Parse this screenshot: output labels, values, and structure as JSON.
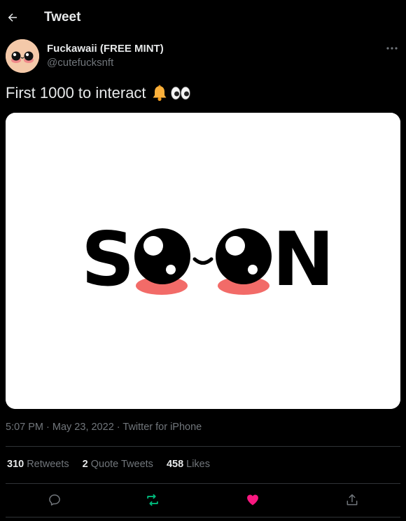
{
  "header": {
    "title": "Tweet",
    "back_icon": "arrow-left-icon"
  },
  "author": {
    "display_name": "Fuckawaii (FREE MINT)",
    "handle": "@cutefucksnft",
    "avatar_icon": "kawaii-face-avatar",
    "more_icon": "more-horizontal-icon"
  },
  "tweet": {
    "text": "First 1000 to interact",
    "emojis": [
      "bell-emoji",
      "eyes-emoji"
    ],
    "media": {
      "wordmark": "SOON",
      "description_icon": "soon-kawaii-eyes-image"
    },
    "time": "5:07 PM",
    "separator": " · ",
    "date": "May 23, 2022",
    "source": "Twitter for iPhone"
  },
  "stats": {
    "retweets": {
      "count": "310",
      "label": "Retweets"
    },
    "quotes": {
      "count": "2",
      "label": "Quote Tweets"
    },
    "likes": {
      "count": "458",
      "label": "Likes"
    }
  },
  "actions": {
    "reply_icon": "reply-icon",
    "retweet_icon": "retweet-icon",
    "like_icon": "heart-icon",
    "share_icon": "share-icon"
  },
  "colors": {
    "background": "#000000",
    "text_primary": "#e7e9ea",
    "text_secondary": "#71767b",
    "divider": "#2f3336",
    "retweet_active": "#00ba7c",
    "like_active": "#f91880"
  }
}
